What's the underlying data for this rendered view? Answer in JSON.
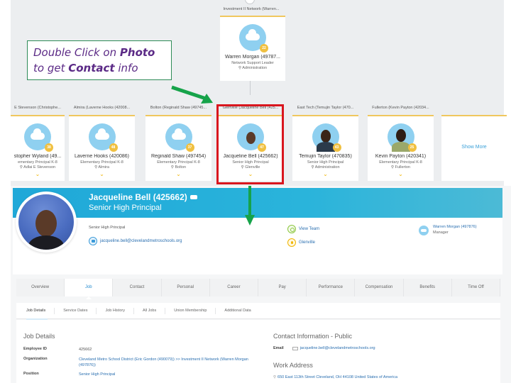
{
  "callout": {
    "line1_prefix": "Double Click on ",
    "line1_bold": "Photo",
    "line2_prefix": "to get ",
    "line2_bold": "Contact",
    "line2_suffix": " info"
  },
  "org_chart": {
    "top_toggle": "^",
    "manager": {
      "org_label": "Investment II Network (Warren...",
      "name": "Warren Morgan (49787...",
      "title": "Network Support Leader",
      "location": "Administration",
      "badge": "22"
    },
    "reports": [
      {
        "org_label": "E Stevenson (Christophe...",
        "name": "stopher Wyland (49...",
        "title": "ementary Principal K-8",
        "location": "Adlai E Stevenson",
        "badge": "38",
        "photo": "none"
      },
      {
        "org_label": "Almira (Laverne Hooks (42008...",
        "name": "Laverne Hooks (420086)",
        "title": "Elementary Principal K-8",
        "location": "Almira",
        "badge": "48",
        "photo": "none"
      },
      {
        "org_label": "Bolton (Reginald Shaw (49745...",
        "name": "Reginald Shaw (497454)",
        "title": "Elementary Principal K-8",
        "location": "Bolton",
        "badge": "37",
        "photo": "none"
      },
      {
        "org_label": "Glenville (Jacqueline Bell (425...",
        "name": "Jacqueline Bell (425662)",
        "title": "Senior High Principal",
        "location": "Glenville",
        "badge": "47",
        "photo": "jacqueline"
      },
      {
        "org_label": "East Tech (Temujin Taylor (470...",
        "name": "Temujin Taylor (470835)",
        "title": "Senior High Principal",
        "location": "Administration",
        "badge": "43",
        "photo": "temujin"
      },
      {
        "org_label": "Fullerton (Kevin Payton (42034...",
        "name": "Kevin Payton (420341)",
        "title": "Elementary Principal K-8",
        "location": "Fullerton",
        "badge": "25",
        "photo": "kevin"
      }
    ],
    "show_more": "Show More",
    "chevron": "⌵"
  },
  "profile": {
    "name": "Jacqueline Bell (425662)",
    "title": "Senior High Principal",
    "subtitle": "Senior High Principal",
    "email": "jacqueline.bell@clevelandmetroschools.org",
    "view_team": "View Team",
    "location": "Glenville",
    "manager_name": "Warren Morgan (497876)",
    "manager_role": "Manager"
  },
  "tabs": [
    {
      "label": "Overview",
      "active": false
    },
    {
      "label": "Job",
      "active": true
    },
    {
      "label": "Contact",
      "active": false
    },
    {
      "label": "Personal",
      "active": false
    },
    {
      "label": "Career",
      "active": false
    },
    {
      "label": "Pay",
      "active": false
    },
    {
      "label": "Performance",
      "active": false
    },
    {
      "label": "Compensation",
      "active": false
    },
    {
      "label": "Benefits",
      "active": false
    },
    {
      "label": "Time Off",
      "active": false
    }
  ],
  "subtabs": [
    {
      "label": "Job Details",
      "active": true
    },
    {
      "label": "Service Dates",
      "active": false
    },
    {
      "label": "Job History",
      "active": false
    },
    {
      "label": "All Jobs",
      "active": false
    },
    {
      "label": "Union Membership",
      "active": false
    },
    {
      "label": "Additional Data",
      "active": false
    }
  ],
  "job_details": {
    "heading": "Job Details",
    "rows": [
      {
        "label": "Employee ID",
        "value": "425662"
      },
      {
        "label": "Organization",
        "value": "Cleveland Metro School District (Eric Gordon (490079)) >> Investment II Network (Warren Morgan (497876))"
      },
      {
        "label": "Position",
        "value": "Senior High Principal"
      }
    ]
  },
  "contact_info": {
    "heading": "Contact Information - Public",
    "email_label": "Email",
    "email_value": "jacqueline.bell@clevelandmetroschools.org",
    "work_address_heading": "Work Address",
    "address": "650 East 113th Street Cleveland, OH 44108 United States of America"
  },
  "colors": {
    "banner": "#1fa8d8",
    "highlight": "#d9161e",
    "arrow": "#16a34a",
    "callout_text": "#5b2a86",
    "link": "#2a6fb0",
    "card_accent": "#f0c75e"
  }
}
